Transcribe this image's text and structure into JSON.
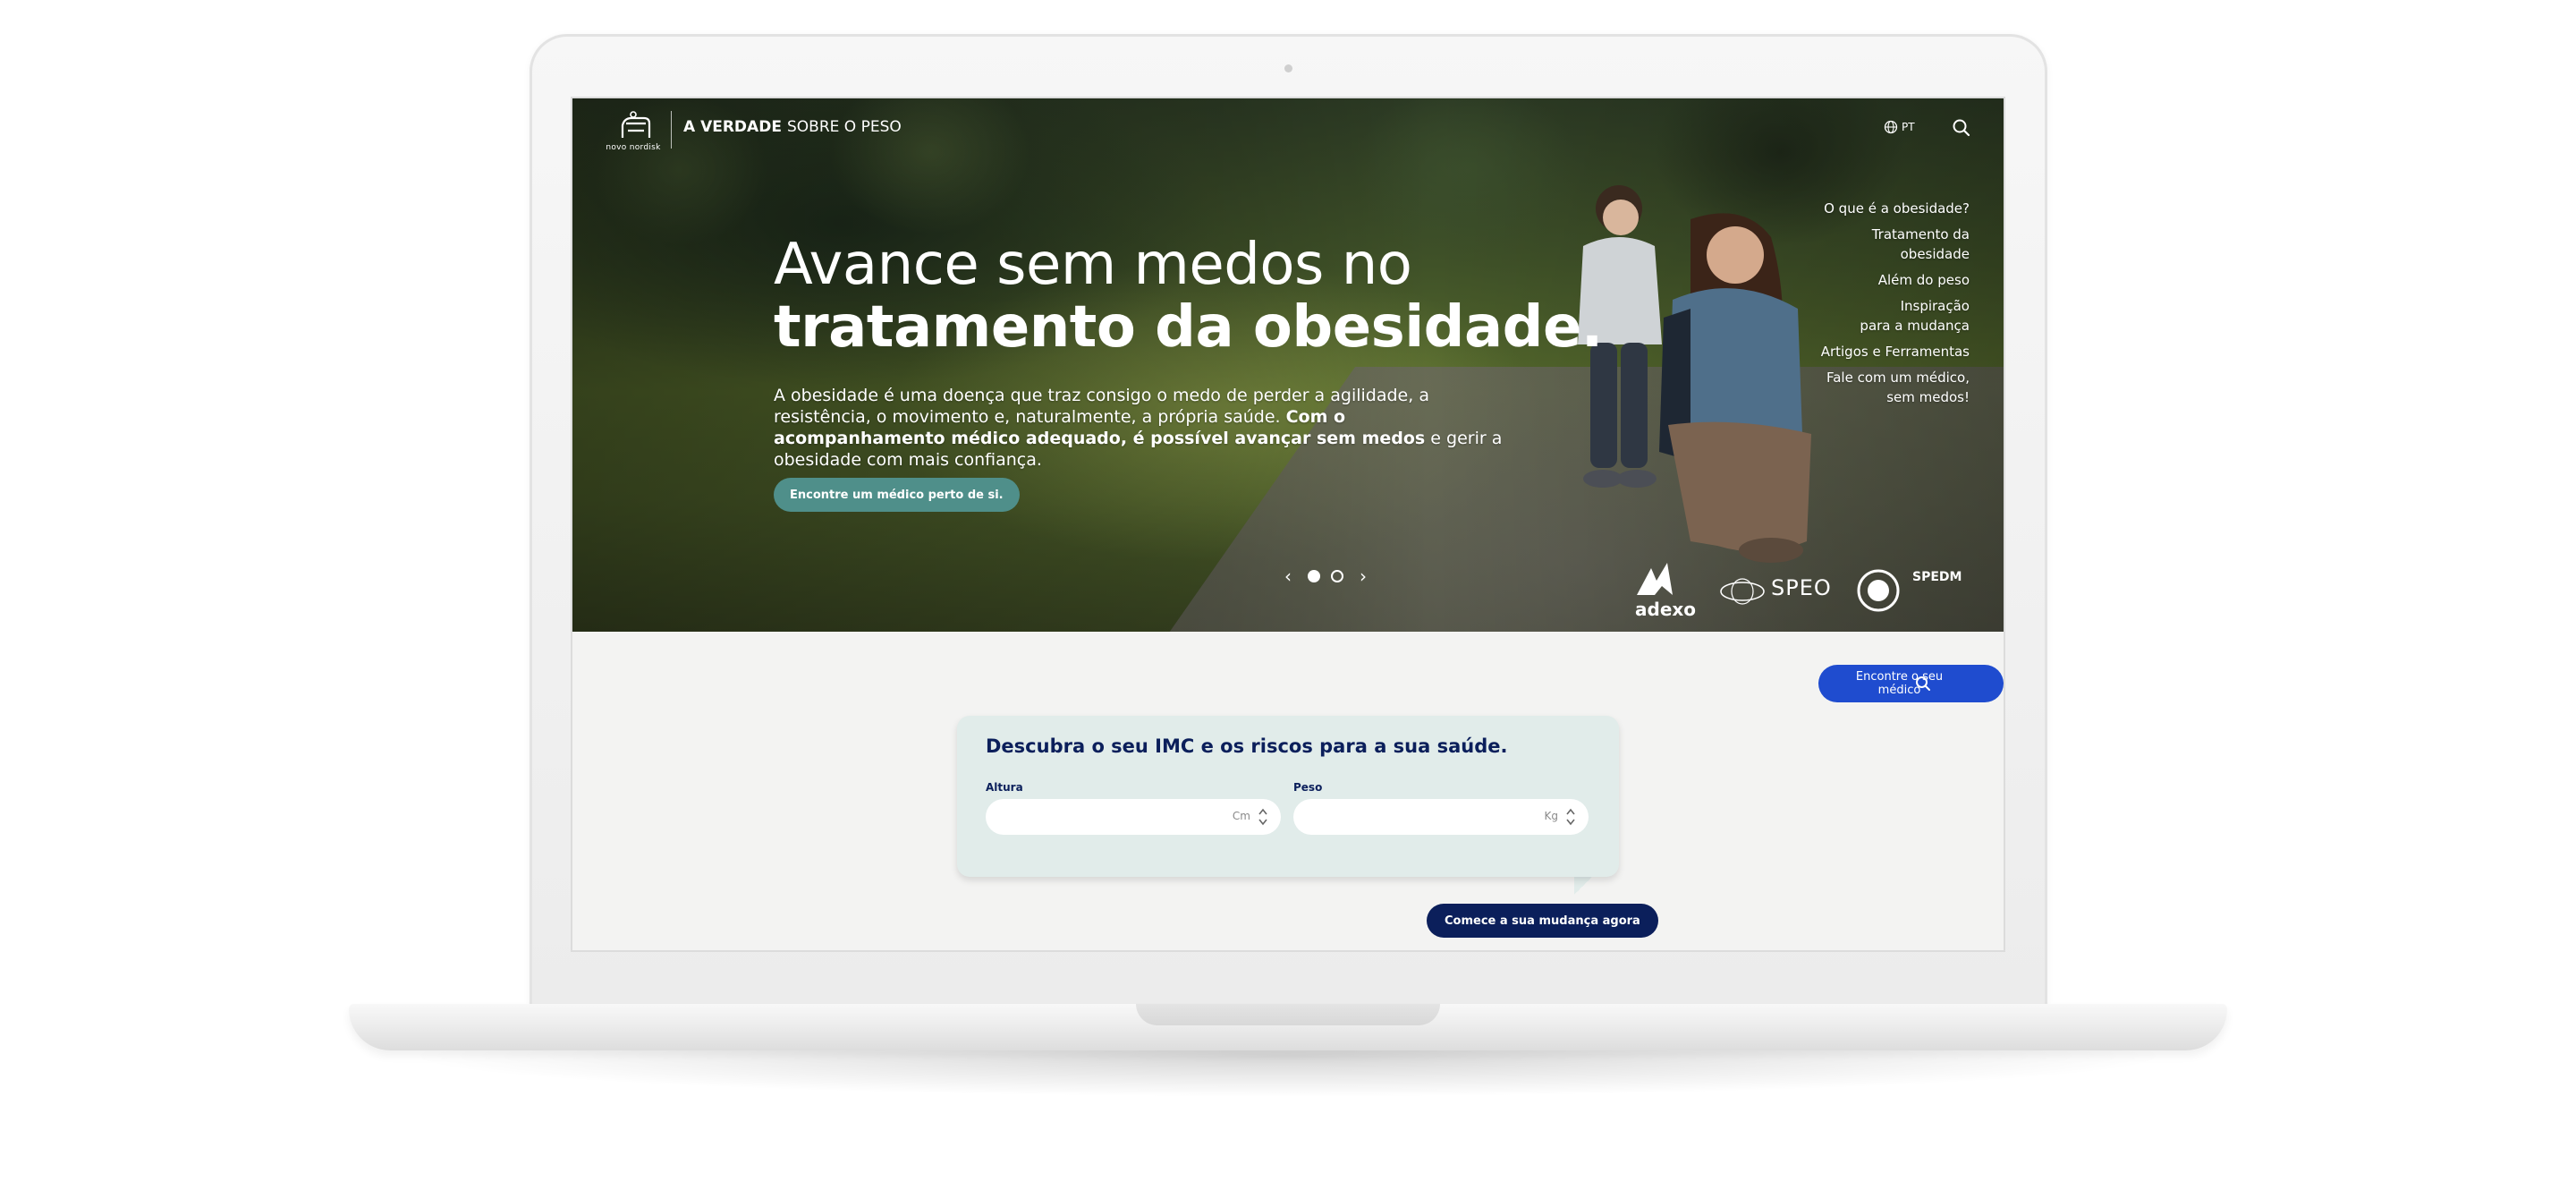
{
  "header": {
    "logo_text": "novo nordisk",
    "brand_bold": "A VERDADE",
    "brand_light": "SOBRE O PESO",
    "language": "PT"
  },
  "side_nav": {
    "items": [
      "O que é a obesidade?",
      "Tratamento da\nobesidade",
      "Além do peso",
      "Inspiração\npara a mudança",
      "Artigos e Ferramentas",
      "Fale com um médico,\nsem medos!"
    ]
  },
  "hero": {
    "title_line1": "Avance sem medos no",
    "title_line2": "tratamento da obesidade.",
    "body_regular": "A obesidade é uma doença que traz consigo o medo de perder a agilidade, a resistência, o movimento e, naturalmente, a própria saúde. ",
    "body_bold": "Com o acompanhamento médico adequado, é possível avançar sem medos",
    "body_end": " e gerir a obesidade com mais confiança.",
    "cta_label": "Encontre um médico perto de si.",
    "carousel": {
      "slides": 2,
      "active": 1,
      "prev_icon": "‹",
      "next_icon": "›"
    }
  },
  "partners": {
    "adexo": "adexo",
    "speo": "SPEO",
    "spedm": "SPEDM"
  },
  "find_doctor": {
    "label": "Encontre o seu médico"
  },
  "bmi": {
    "title": "Descubra o seu IMC e os riscos para a sua saúde.",
    "height_label": "Altura",
    "height_unit": "Cm",
    "height_value": "",
    "weight_label": "Peso",
    "weight_unit": "Kg",
    "weight_value": "",
    "cta_label": "Comece a sua mudança agora"
  },
  "colors": {
    "teal_button": "#4f8f8a",
    "blue_button": "#1f4ccf",
    "navy": "#0b1f5b",
    "card_bg": "#e1ecea",
    "page_bg": "#f3f3f2"
  }
}
